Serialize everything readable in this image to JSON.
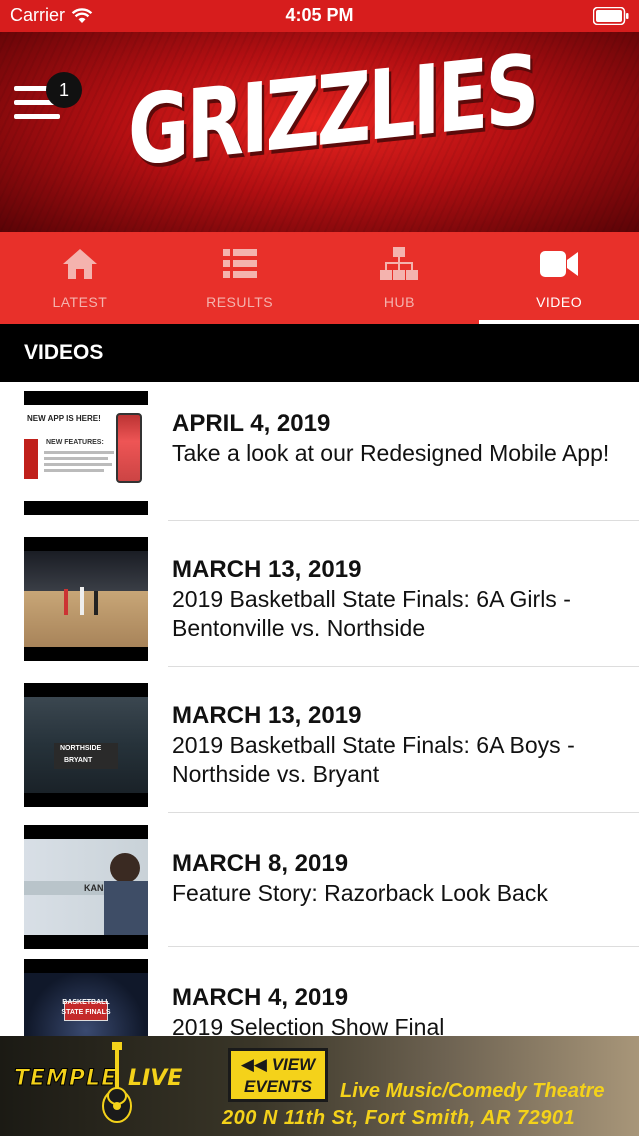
{
  "status_bar": {
    "carrier": "Carrier",
    "time": "4:05 PM"
  },
  "header": {
    "title": "GRIZZLIES",
    "menu_badge": "1"
  },
  "tabs": [
    {
      "label": "LATEST",
      "icon": "home-icon",
      "active": false
    },
    {
      "label": "RESULTS",
      "icon": "list-icon",
      "active": false
    },
    {
      "label": "HUB",
      "icon": "sitemap-icon",
      "active": false
    },
    {
      "label": "VIDEO",
      "icon": "video-camera-icon",
      "active": true
    }
  ],
  "section": {
    "title": "VIDEOS"
  },
  "videos": [
    {
      "date": "APRIL 4, 2019",
      "title": "Take a look at our Redesigned Mobile App!",
      "thumb_text": "NEW APP IS HERE!",
      "thumb_sub": "NEW FEATURES:"
    },
    {
      "date": "MARCH 13, 2019",
      "title": "2019 Basketball State Finals: 6A Girls - Bentonville vs. Northside"
    },
    {
      "date": "MARCH 13, 2019",
      "title": "2019 Basketball State Finals: 6A Boys - Northside vs. Bryant",
      "thumb_text": "NORTHSIDE",
      "thumb_sub": "BRYANT"
    },
    {
      "date": "MARCH 8, 2019",
      "title": "Feature Story: Razorback Look Back",
      "thumb_text": "KANS"
    },
    {
      "date": "MARCH 4, 2019",
      "title": "2019 Selection Show Final",
      "thumb_text": "BASKETBALL",
      "thumb_sub": "STATE FINALS"
    }
  ],
  "ad": {
    "brand_left": "TEMPLE",
    "brand_right": "LIVE",
    "button": "VIEW EVENTS",
    "button_prefix": "◀◀",
    "tagline": "Live Music/Comedy Theatre",
    "address": "200 N 11th St, Fort Smith, AR 72901"
  },
  "colors": {
    "brand_red": "#d71d1d",
    "tab_red": "#e8302a",
    "ad_yellow": "#f4d21a"
  }
}
